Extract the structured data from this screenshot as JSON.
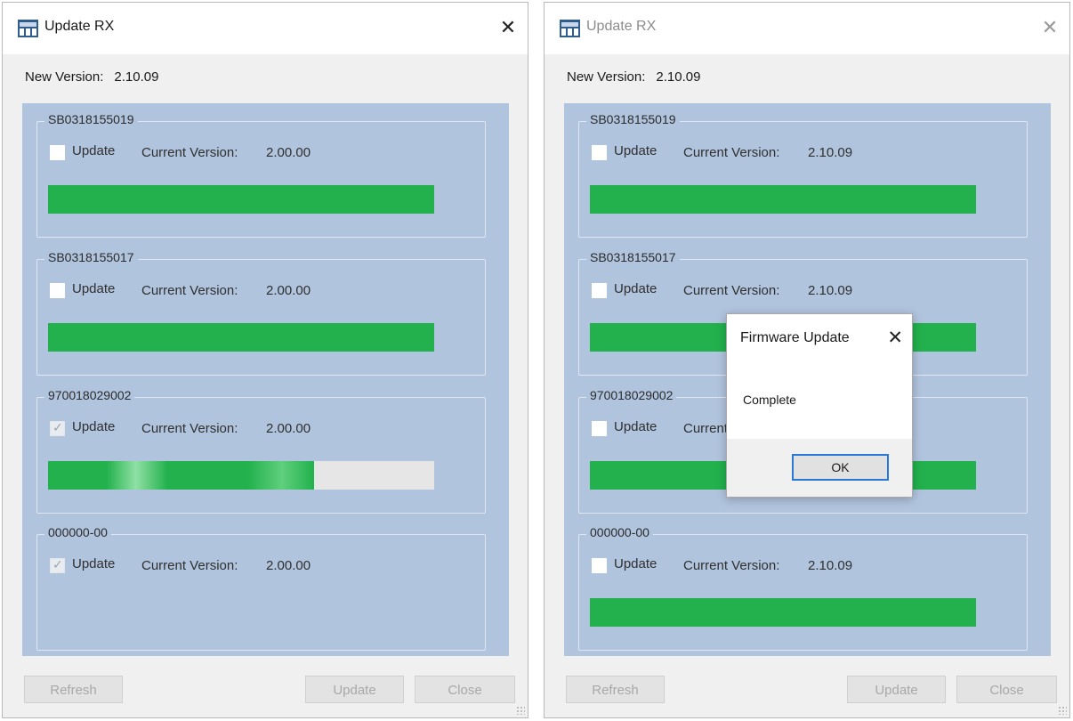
{
  "colors": {
    "panel_bg": "#b1c4de",
    "progress_green": "#22b14c",
    "dialog_focus": "#2a78d6"
  },
  "left": {
    "title": "Update RX",
    "close_glyph": "✕",
    "new_version_label": "New Version:",
    "new_version_value": "2.10.09",
    "devices": [
      {
        "id": "SB0318155019",
        "update_label": "Update",
        "checked": false,
        "current_version_label": "Current Version:",
        "current_version": "2.00.00",
        "progress": 1.0
      },
      {
        "id": "SB0318155017",
        "update_label": "Update",
        "checked": false,
        "current_version_label": "Current Version:",
        "current_version": "2.00.00",
        "progress": 1.0
      },
      {
        "id": "970018029002",
        "update_label": "Update",
        "checked": true,
        "current_version_label": "Current Version:",
        "current_version": "2.00.00",
        "progress": 0.69
      },
      {
        "id": "000000-00",
        "update_label": "Update",
        "checked": true,
        "current_version_label": "Current Version:",
        "current_version": "2.00.00",
        "progress": null
      }
    ],
    "buttons": {
      "refresh": "Refresh",
      "update": "Update",
      "close": "Close"
    }
  },
  "right": {
    "title": "Update RX",
    "close_glyph": "✕",
    "new_version_label": "New Version:",
    "new_version_value": "2.10.09",
    "devices": [
      {
        "id": "SB0318155019",
        "update_label": "Update",
        "checked": false,
        "current_version_label": "Current Version:",
        "current_version": "2.10.09",
        "progress": 1.0
      },
      {
        "id": "SB0318155017",
        "update_label": "Update",
        "checked": false,
        "current_version_label": "Current Version:",
        "current_version": "2.10.09",
        "progress": 1.0
      },
      {
        "id": "970018029002",
        "update_label": "Update",
        "checked": false,
        "current_version_label": "Current",
        "current_version": "",
        "progress": 1.0
      },
      {
        "id": "000000-00",
        "update_label": "Update",
        "checked": false,
        "current_version_label": "Current Version:",
        "current_version": "2.10.09",
        "progress": 1.0
      }
    ],
    "buttons": {
      "refresh": "Refresh",
      "update": "Update",
      "close": "Close"
    }
  },
  "dialog": {
    "title": "Firmware Update",
    "close_glyph": "✕",
    "message": "Complete",
    "ok_label": "OK"
  }
}
